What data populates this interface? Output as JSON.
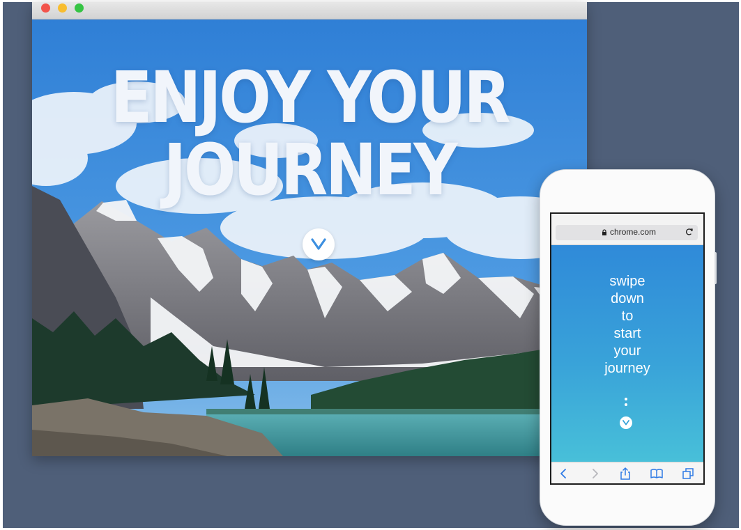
{
  "desktop": {
    "hero": {
      "title_line1": "ENJOY YOUR",
      "title_line2": "JOURNEY"
    },
    "scroll_button_icon": "chevron-down-icon"
  },
  "phone": {
    "url": "chrome.com",
    "url_icons": [
      "lock-icon",
      "reload-icon"
    ],
    "message_lines": [
      "swipe",
      "down",
      "to",
      "start",
      "your",
      "journey"
    ],
    "toolbar_icons": [
      "back-icon",
      "forward-icon",
      "share-icon",
      "bookmarks-icon",
      "tabs-icon"
    ]
  },
  "colors": {
    "page_background": "#4f5f79",
    "sky_blue": "#3a86d6",
    "phone_gradient_top": "#2f8ad9",
    "phone_gradient_bottom": "#48c0d9",
    "ios_blue": "#2f7be5"
  }
}
